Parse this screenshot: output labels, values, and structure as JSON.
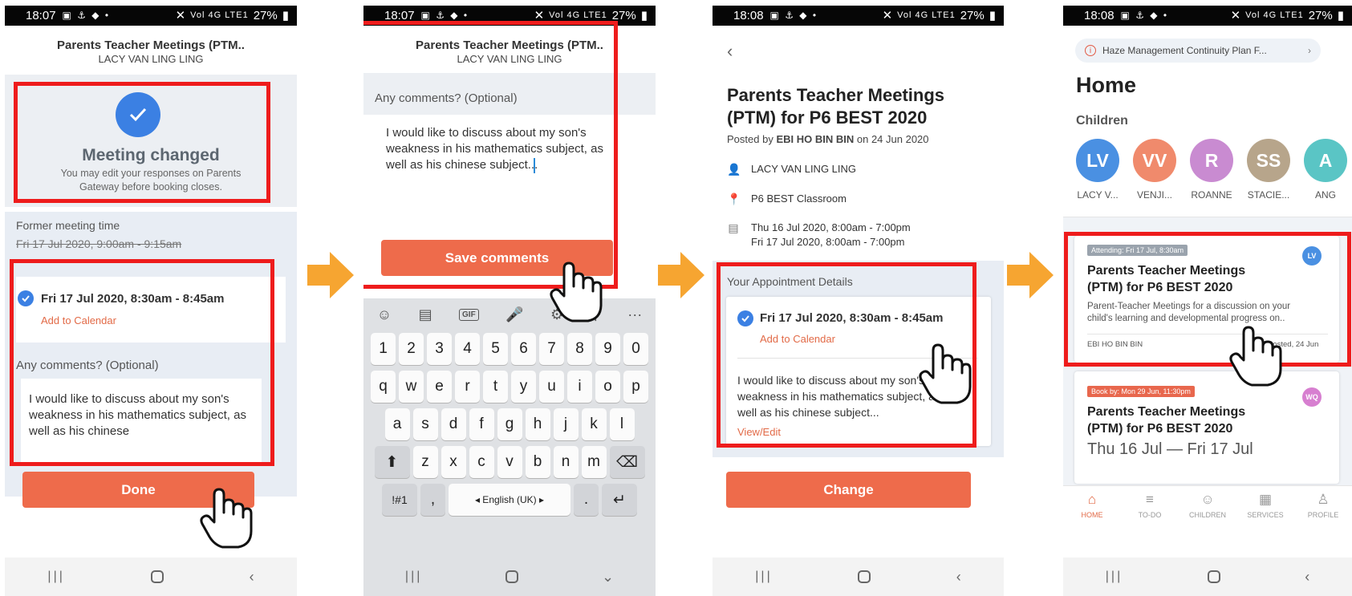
{
  "status_bars": [
    {
      "time": "18:07",
      "battery": "27%"
    },
    {
      "time": "18:07",
      "battery": "27%"
    },
    {
      "time": "18:08",
      "battery": "27%"
    },
    {
      "time": "18:08",
      "battery": "27%"
    }
  ],
  "status_icons": "▣ ⚓ ◆ •",
  "status_signal": "Vol 4G LTE1",
  "screen1": {
    "header_title": "Parents Teacher Meetings (PTM..",
    "header_sub": "LACY VAN LING LING",
    "banner_title": "Meeting changed",
    "banner_text_1": "You may edit your responses on Parents",
    "banner_text_2": "Gateway before booking closes.",
    "former_label": "Former meeting time",
    "former_time": "Fri 17 Jul 2020, 9:00am - 9:15am",
    "slot": "Fri 17 Jul 2020, 8:30am - 8:45am",
    "add_calendar": "Add to Calendar",
    "comments_label": "Any comments? (Optional)",
    "comment_line_1": "I would like to discuss about my son's",
    "comment_line_2": "weakness in his mathematics subject, as",
    "comment_line_3": "well as his chinese",
    "done_button": "Done"
  },
  "screen2": {
    "header_title": "Parents Teacher Meetings (PTM..",
    "header_sub": "LACY VAN LING LING",
    "comments_label": "Any comments? (Optional)",
    "comment_line_1": "I would like to discuss about my son's",
    "comment_line_2": "weakness in his mathematics subject, as",
    "comment_line_3": "well as his chinese subject...",
    "save_button": "Save comments",
    "keyboard": {
      "toolbar": [
        "☺",
        "▤",
        "GIF",
        "🎤",
        "⚙",
        "⚲",
        "···"
      ],
      "row_numbers": [
        "1",
        "2",
        "3",
        "4",
        "5",
        "6",
        "7",
        "8",
        "9",
        "0"
      ],
      "row_top": [
        "q",
        "w",
        "e",
        "r",
        "t",
        "y",
        "u",
        "i",
        "o",
        "p"
      ],
      "row_mid": [
        "a",
        "s",
        "d",
        "f",
        "g",
        "h",
        "j",
        "k",
        "l"
      ],
      "row_bottom": [
        "z",
        "x",
        "c",
        "v",
        "b",
        "n",
        "m"
      ],
      "shift": "⬆",
      "backspace": "⌫",
      "symbols": "!#1",
      "comma": ",",
      "space": "◂ English (UK) ▸",
      "period": ".",
      "enter": "↵"
    }
  },
  "screen3": {
    "back": "‹",
    "title_line_1": "Parents Teacher Meetings",
    "title_line_2": "(PTM) for P6 BEST 2020",
    "posted_prefix": "Posted by",
    "posted_by": "EBI HO BIN BIN",
    "posted_suffix": "on 24 Jun 2020",
    "child_name": "LACY VAN LING LING",
    "location": "P6 BEST Classroom",
    "date_line_1": "Thu 16 Jul 2020, 8:00am - 7:00pm",
    "date_line_2": "Fri 17 Jul 2020, 8:00am - 7:00pm",
    "appt_label": "Your Appointment Details",
    "slot": "Fri 17 Jul 2020, 8:30am - 8:45am",
    "add_calendar": "Add to Calendar",
    "comment_line_1": "I would like to discuss about my son's",
    "comment_line_2": "weakness in his mathematics subject, as",
    "comment_line_3": "well as his chinese subject...",
    "view_edit": "View/Edit",
    "change_button": "Change"
  },
  "screen4": {
    "alert": "Haze Management Continuity Plan F...",
    "home_title": "Home",
    "children_label": "Children",
    "children": [
      {
        "initials": "LV",
        "name": "LACY V...",
        "color": "#4a90e2"
      },
      {
        "initials": "VV",
        "name": "VENJI...",
        "color": "#f08a6c"
      },
      {
        "initials": "R",
        "name": "ROANNE",
        "color": "#c98bd1"
      },
      {
        "initials": "SS",
        "name": "STACIE...",
        "color": "#b7a58b"
      },
      {
        "initials": "A",
        "name": "ANG",
        "color": "#5ac5c5"
      }
    ],
    "card1": {
      "tag": "Attending: Fri 17 Jul, 8:30am",
      "avatar": "LV",
      "title_1": "Parents Teacher Meetings",
      "title_2": "(PTM) for P6 BEST 2020",
      "desc_1": "Parent-Teacher Meetings for a discussion on your",
      "desc_2": "child's learning and developmental progress on..",
      "author": "EBI HO BIN BIN",
      "date": "Posted, 24 Jun"
    },
    "card2": {
      "tag": "Book by: Mon 29 Jun, 11:30pm",
      "avatar": "WQ",
      "title_1": "Parents Teacher Meetings",
      "title_2": "(PTM) for P6 BEST 2020",
      "dates": "Thu 16 Jul — Fri 17 Jul"
    },
    "tabs": [
      {
        "label": "HOME",
        "icon": "⌂"
      },
      {
        "label": "TO-DO",
        "icon": "≡"
      },
      {
        "label": "CHILDREN",
        "icon": "☺"
      },
      {
        "label": "SERVICES",
        "icon": "▦"
      },
      {
        "label": "PROFILE",
        "icon": "♙"
      }
    ]
  },
  "nav": {
    "recent": "|||",
    "back": "‹"
  },
  "colors": {
    "accent": "#ee6b4b",
    "highlight_box": "#ee1c1c",
    "check_blue": "#3b80e3",
    "arrow": "#f6a531"
  }
}
